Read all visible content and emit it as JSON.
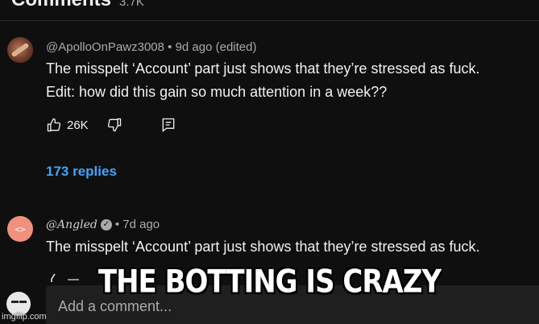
{
  "header": {
    "title": "Comments",
    "count": "3.7K"
  },
  "comments": [
    {
      "author_meta": "@ApolloOnPawz3008 • 9d ago (edited)",
      "lines": [
        "The misspelt ‘Account’ part just shows that they’re stressed as fuck.",
        "Edit: how did this gain so much attention in a week??"
      ],
      "likes": "26K",
      "replies_label": "173 replies",
      "avatar_icon": "feather-avatar-icon"
    },
    {
      "author": "@Angled",
      "time": "• 7d ago",
      "verified_icon": "verified-check-icon",
      "avatar_text": "<>",
      "lines": [
        "The misspelt ‘Account’ part just shows that they’re stressed as fuck."
      ]
    }
  ],
  "add_comment": {
    "placeholder": "Add a comment..."
  },
  "meme_caption": "THE BOTTING IS CRAZY",
  "watermark": "imgflip.com",
  "colors": {
    "background": "#0f0f0f",
    "link": "#3ea6ff",
    "muted": "#aaaaaa",
    "text": "#f1f1f1"
  }
}
